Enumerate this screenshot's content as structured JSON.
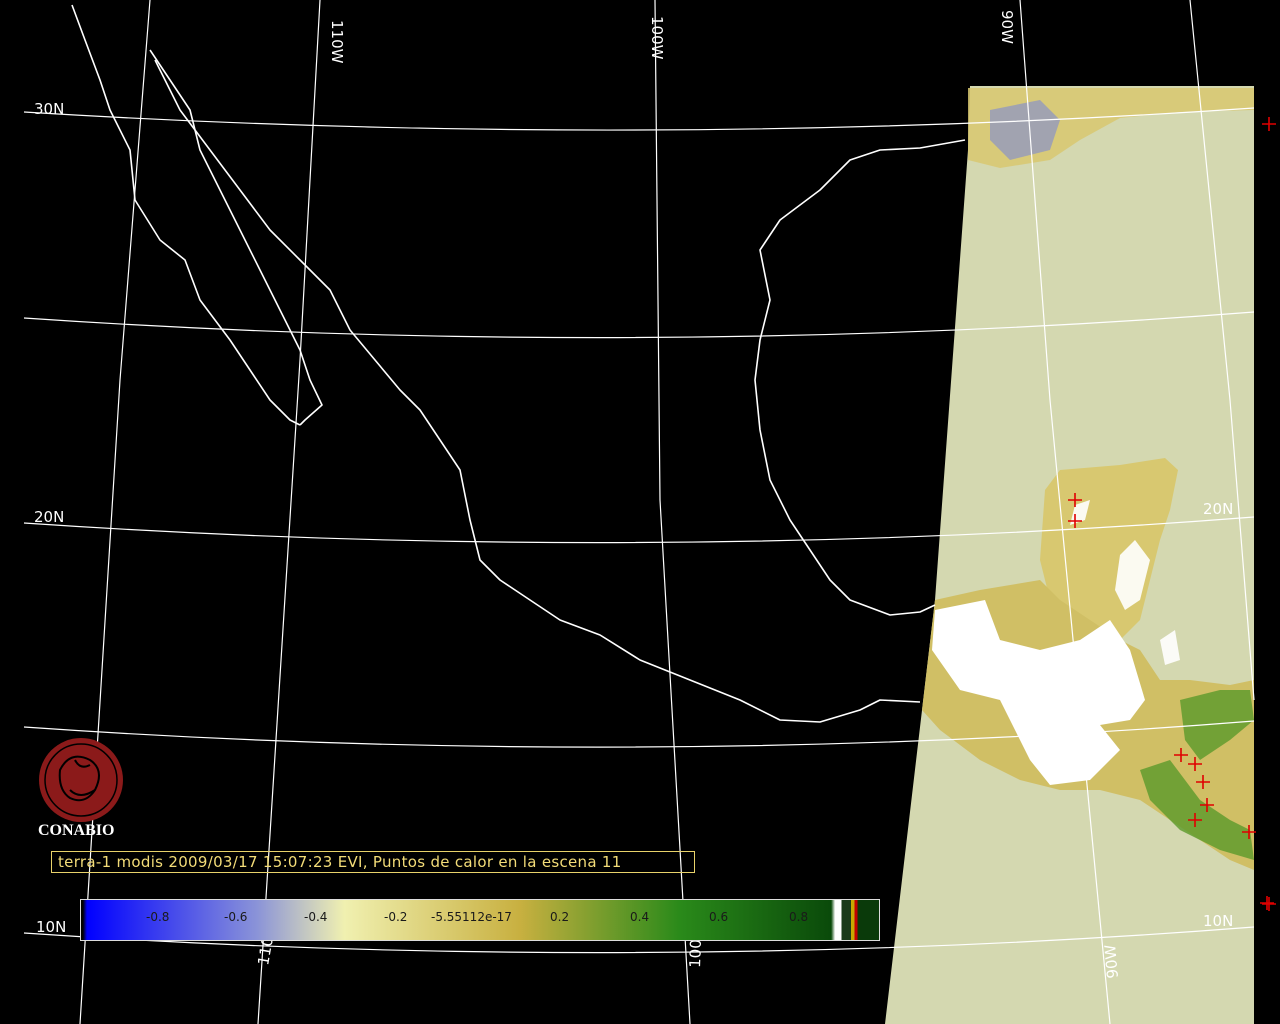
{
  "caption": "terra-1 modis 2009/03/17 15:07:23 EVI, Puntos de calor en la escena 11",
  "logo": {
    "text": "CONABIO",
    "color": "#8b1a1a"
  },
  "graticule_labels": {
    "top": [
      "110W",
      "100W",
      "90W"
    ],
    "bottom": [
      "110W",
      "100W",
      "90W"
    ],
    "left": [
      "30N",
      "20N",
      "10N"
    ],
    "right": [
      "20N",
      "10N"
    ]
  },
  "colorbar": {
    "ticks": [
      "-0.8",
      "-0.6",
      "-0.4",
      "-0.2",
      "-5.55112e-17",
      "0.2",
      "0.4",
      "0.6",
      "0.8"
    ],
    "colors": [
      "#0000ff",
      "#8a93d8",
      "#f0f0b0",
      "#c8b040",
      "#2a8a1a",
      "#0a4a0a"
    ]
  },
  "colors": {
    "background": "#000000",
    "land_no_data": "#d4d8b0",
    "cloud": "#ffffff",
    "fire_marker": "#e00000"
  },
  "fire_markers_count": 11
}
